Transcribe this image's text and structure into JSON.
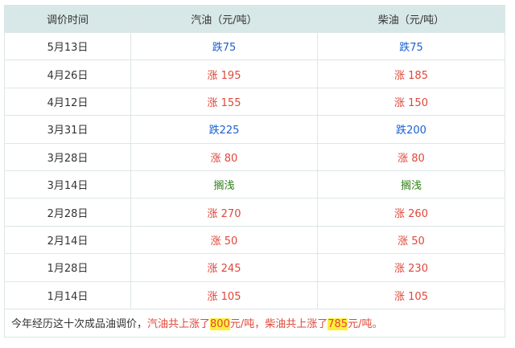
{
  "table": {
    "headers": [
      "调价时间",
      "汽油（元/吨）",
      "柴油（元/吨）"
    ],
    "rows": [
      {
        "date": "5月13日",
        "gasoline": "跌75",
        "diesel": "跌75",
        "gas_type": "down",
        "diesel_type": "down"
      },
      {
        "date": "4月26日",
        "gasoline": "涨 195",
        "diesel": "涨 185",
        "gas_type": "up",
        "diesel_type": "up"
      },
      {
        "date": "4月12日",
        "gasoline": "涨 155",
        "diesel": "涨 150",
        "gas_type": "up",
        "diesel_type": "up"
      },
      {
        "date": "3月31日",
        "gasoline": "跌225",
        "diesel": "跌200",
        "gas_type": "down",
        "diesel_type": "down"
      },
      {
        "date": "3月28日",
        "gasoline": "涨 80",
        "diesel": "涨 80",
        "gas_type": "up",
        "diesel_type": "up"
      },
      {
        "date": "3月14日",
        "gasoline": "搁浅",
        "diesel": "搁浅",
        "gas_type": "flat",
        "diesel_type": "flat"
      },
      {
        "date": "2月28日",
        "gasoline": "涨 270",
        "diesel": "涨 260",
        "gas_type": "up",
        "diesel_type": "up"
      },
      {
        "date": "2月14日",
        "gasoline": "涨 50",
        "diesel": "涨 50",
        "gas_type": "up",
        "diesel_type": "up"
      },
      {
        "date": "1月28日",
        "gasoline": "涨 245",
        "diesel": "涨 230",
        "gas_type": "up",
        "diesel_type": "up"
      },
      {
        "date": "1月14日",
        "gasoline": "涨 105",
        "diesel": "涨 105",
        "gas_type": "up",
        "diesel_type": "up"
      }
    ]
  },
  "summary": {
    "prefix": "今年经历这十次成品油调价，",
    "gas_pre": "汽油共上涨了",
    "gas_total": "800",
    "gas_unit": "元/吨，",
    "diesel_pre": "柴油共上涨了",
    "diesel_total": "785",
    "diesel_unit": "元/吨。"
  },
  "colors": {
    "header_bg": "#d8e7e7",
    "rise": "#e0473a",
    "fall": "#1a5fd0",
    "stall": "#2e7d14",
    "highlight": "#ffef3a"
  }
}
